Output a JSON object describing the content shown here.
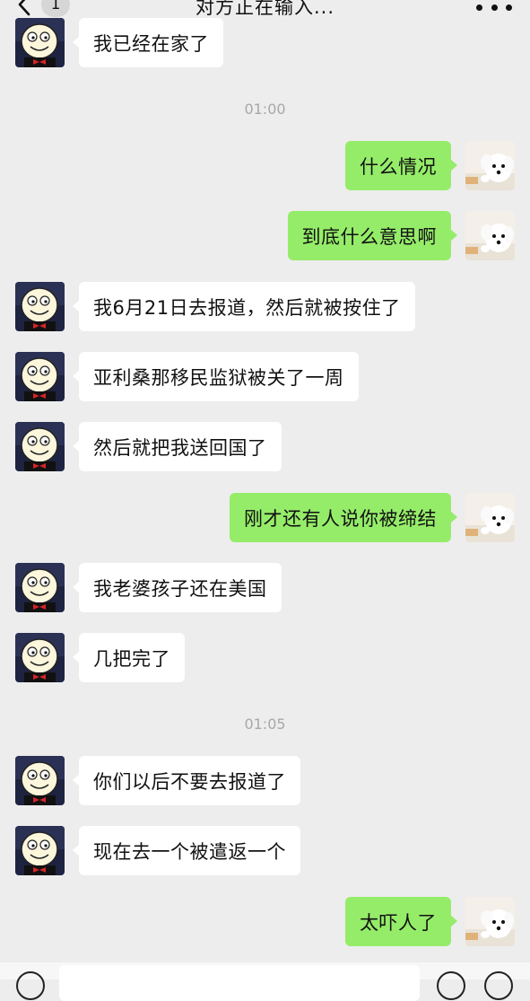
{
  "header": {
    "back_badge": "1",
    "title": "对方正在输入..."
  },
  "icons": {
    "back": "chevron-left-icon",
    "more": "more-dots-icon",
    "contact_avatar": "cartoon-face-avatar",
    "my_avatar": "white-dog-avatar"
  },
  "colors": {
    "background": "#ededed",
    "my_bubble": "#95ec69",
    "their_bubble": "#ffffff",
    "timestamp": "#a8a8a8"
  },
  "chat": {
    "time_1": "01:00",
    "time_2": "01:05",
    "messages": [
      {
        "side": "left",
        "text": "我已经在家了"
      },
      {
        "side": "right",
        "text": "什么情况"
      },
      {
        "side": "right",
        "text": "到底什么意思啊"
      },
      {
        "side": "left",
        "text": "我6月21日去报道，然后就被按住了"
      },
      {
        "side": "left",
        "text": "亚利桑那移民监狱被关了一周"
      },
      {
        "side": "left",
        "text": "然后就把我送回国了"
      },
      {
        "side": "right",
        "text": "刚才还有人说你被缔结"
      },
      {
        "side": "left",
        "text": "我老婆孩子还在美国"
      },
      {
        "side": "left",
        "text": "几把完了"
      },
      {
        "side": "left",
        "text": "你们以后不要去报道了"
      },
      {
        "side": "left",
        "text": "现在去一个被遣返一个"
      },
      {
        "side": "right",
        "text": "太吓人了"
      }
    ]
  }
}
